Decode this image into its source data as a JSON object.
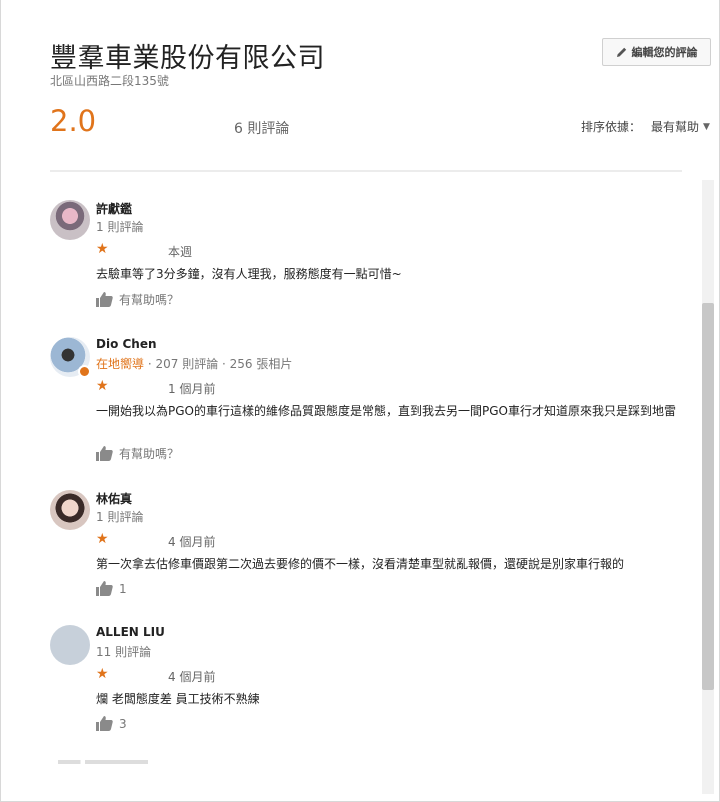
{
  "business": {
    "name": "豐羣車業股份有限公司",
    "address": "北區山西路二段135號",
    "rating": "2.0",
    "review_count": "6 則評論",
    "edit_button": "編輯您的評論",
    "sort_label": "排序依據：",
    "sort_value": "最有幫助"
  },
  "colors": {
    "accent": "#e0741b",
    "text": "#222222",
    "muted": "#777777"
  },
  "reviews": [
    {
      "name": "許獻鑑",
      "meta": "1 則評論",
      "stars": 1,
      "time": "本週",
      "text": "去驗車等了3分多鐘，沒有人理我，服務態度有一點可惜~",
      "helpful": "有幫助嗎？"
    },
    {
      "name": "Dio Chen",
      "guide": "在地嚮導",
      "meta": "· 207 則評論 · 256 張相片",
      "stars": 1,
      "time": "1 個月前",
      "text": "一開始我以為PGO的車行這樣的維修品質跟態度是常態，直到我去另一間PGO車行才知道原來我只是踩到地雷",
      "helpful": "有幫助嗎？"
    },
    {
      "name": "林佑真",
      "meta": "1 則評論",
      "stars": 1,
      "time": "4 個月前",
      "text": "第一次拿去估修車價跟第二次過去要修的價不一樣，沒看清楚車型就亂報價，還硬說是別家車行報的",
      "helpful": "1"
    },
    {
      "name": "ALLEN LIU",
      "meta": "11 則評論",
      "stars": 1,
      "time": "4 個月前",
      "text": "爛 老闆態度差 員工技術不熟練",
      "helpful": "3"
    }
  ],
  "icons": {
    "edit": "pencil-icon",
    "like": "thumbs-up-icon",
    "sort": "caret-down-icon",
    "star": "star-icon"
  }
}
